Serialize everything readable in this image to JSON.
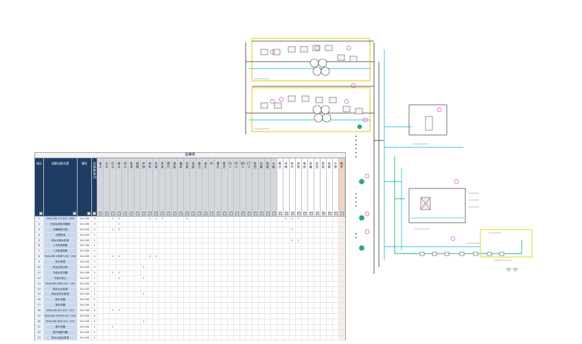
{
  "sheet": {
    "title": "設備表",
    "headers": [
      "項次",
      "設備名稱/位置",
      "類型",
      "設備數量(台)",
      "進水",
      "出水",
      "回水",
      "補水",
      "排水",
      "電源",
      "開關",
      "控制",
      "感知",
      "泵浦",
      "馬達",
      "閥門",
      "管路",
      "儀表",
      "流量",
      "溫度",
      "壓力",
      "液位",
      "AC",
      "備註",
      "電控",
      "PLC",
      "RTU",
      "EMS",
      "CTU",
      "監控",
      "加藥",
      "過濾",
      "水箱",
      "備註",
      "採樣",
      "附件",
      "狀態",
      "維修",
      "保養",
      "保固",
      "更換",
      "巡檢",
      "日期",
      "備考"
    ],
    "header_colors": [
      "navy",
      "navy",
      "navy",
      "navy",
      "grey",
      "grey",
      "grey",
      "grey",
      "grey",
      "grey",
      "grey",
      "grey",
      "grey",
      "grey",
      "grey",
      "grey",
      "grey",
      "grey",
      "grey",
      "grey",
      "grey",
      "grey",
      "grey",
      "grey",
      "grey",
      "grey",
      "grey",
      "grey",
      "grey",
      "grey",
      "grey",
      "grey",
      "grey",
      "white",
      "white",
      "white",
      "white",
      "white",
      "white",
      "white",
      "white",
      "white",
      "white",
      "peach"
    ],
    "rows": [
      [
        "1",
        "FASA-ME-CH-201~204",
        "2A-CUB",
        "4",
        "",
        "",
        "1",
        "1",
        "",
        "",
        "",
        "",
        "1",
        "1",
        "1",
        "",
        "",
        "",
        "1",
        "",
        "",
        "",
        "",
        "",
        "",
        "",
        "",
        "",
        "",
        "",
        "",
        "",
        "",
        "",
        "1",
        "1",
        "1",
        "",
        "",
        "",
        "",
        "",
        "",
        ""
      ],
      [
        "2",
        "冷卻水泵與本體機",
        "2A-CUB",
        "2",
        "",
        "",
        "",
        "1",
        "",
        "",
        "",
        "",
        "",
        "",
        "",
        "",
        "",
        "",
        "",
        "",
        "",
        "",
        "",
        "",
        "",
        "",
        "",
        "",
        "",
        "",
        "",
        "",
        "",
        "",
        "",
        "",
        "",
        "",
        "",
        "",
        "",
        "",
        "",
        ""
      ],
      [
        "3",
        "冰機機房冷卻",
        "2A-CUB",
        "2",
        "",
        "",
        "1",
        "1",
        "",
        "",
        "",
        "",
        "",
        "",
        "",
        "",
        "",
        "",
        "",
        "",
        "",
        "",
        "",
        "",
        "",
        "",
        "",
        "",
        "",
        "",
        "",
        "",
        "",
        "",
        "",
        "1",
        "",
        "",
        "",
        "",
        "",
        "",
        "",
        ""
      ],
      [
        "4",
        "主要泵浦",
        "2A-CUB",
        "1",
        "",
        "",
        "",
        "",
        "",
        "",
        "",
        "",
        "",
        "",
        "",
        "",
        "",
        "",
        "",
        "",
        "",
        "",
        "",
        "",
        "",
        "",
        "",
        "",
        "",
        "",
        "",
        "",
        "",
        "",
        "",
        "",
        "",
        "",
        "",
        "",
        "",
        "",
        "",
        ""
      ],
      [
        "5",
        "熱水空調水泵浦",
        "2A-CUB",
        "1",
        "",
        "",
        "",
        "",
        "",
        "",
        "",
        "",
        "",
        "",
        "",
        "",
        "",
        "",
        "",
        "",
        "",
        "",
        "",
        "",
        "",
        "",
        "",
        "",
        "",
        "",
        "",
        "",
        "",
        "",
        "",
        "1",
        "1",
        "",
        "",
        "",
        "",
        "",
        "",
        ""
      ],
      [
        "6",
        "L-R泵浦本體",
        "2A-CUB",
        "1",
        "",
        "",
        "",
        "",
        "",
        "",
        "",
        "",
        "",
        "",
        "",
        "",
        "",
        "",
        "",
        "",
        "",
        "",
        "",
        "",
        "",
        "",
        "",
        "",
        "",
        "",
        "",
        "",
        "",
        "",
        "",
        "",
        "",
        "",
        "",
        "",
        "",
        "",
        "",
        ""
      ],
      [
        "7",
        "L-R泵浦本體",
        "2A-CUB",
        "1",
        "",
        "",
        "",
        "",
        "",
        "",
        "",
        "",
        "",
        "",
        "",
        "",
        "",
        "",
        "",
        "",
        "",
        "",
        "",
        "",
        "",
        "",
        "",
        "",
        "",
        "",
        "",
        "",
        "",
        "",
        "",
        "",
        "",
        "",
        "",
        "",
        "",
        "",
        "",
        ""
      ],
      [
        "8",
        "FASA-ME-HRWP-202~204",
        "2A-CUB",
        "4",
        "",
        "",
        "1",
        "1",
        "",
        "",
        "",
        "",
        "1",
        "1",
        "",
        "",
        "",
        "",
        "",
        "",
        "",
        "",
        "",
        "",
        "",
        "",
        "",
        "",
        "",
        "",
        "",
        "",
        "",
        "",
        "",
        "",
        "",
        "",
        "",
        "",
        "",
        "",
        "",
        ""
      ],
      [
        "9",
        "熱水泵頭",
        "2A-CUB",
        "1",
        "",
        "",
        "",
        "",
        "",
        "",
        "",
        "",
        "",
        "",
        "",
        "",
        "",
        "",
        "",
        "",
        "",
        "",
        "",
        "",
        "",
        "",
        "",
        "",
        "",
        "",
        "",
        "",
        "",
        "",
        "",
        "",
        "",
        "",
        "",
        "",
        "",
        "",
        "",
        ""
      ],
      [
        "10",
        "熱水回流水泵",
        "2A-CUB",
        "2",
        "",
        "",
        "",
        "",
        "",
        "",
        "",
        "1",
        "",
        "",
        "",
        "",
        "",
        "",
        "",
        "",
        "",
        "",
        "",
        "",
        "",
        "",
        "",
        "",
        "",
        "",
        "",
        "",
        "",
        "",
        "",
        "",
        "",
        "",
        "",
        "",
        "",
        "",
        "",
        ""
      ],
      [
        "11",
        "冷卻水泵本體",
        "2A-CUB",
        "2",
        "",
        "",
        "1",
        "1",
        "",
        "",
        "",
        "",
        "",
        "",
        "",
        "",
        "",
        "",
        "",
        "",
        "",
        "",
        "",
        "",
        "",
        "",
        "",
        "",
        "",
        "",
        "",
        "",
        "",
        "",
        "",
        "",
        "",
        "",
        "",
        "",
        "",
        "",
        "",
        ""
      ],
      [
        "12",
        "冷卻水泵主",
        "2A-CUB",
        "1",
        "",
        "",
        "",
        "1",
        "",
        "",
        "",
        "1",
        "",
        "",
        "",
        "",
        "",
        "",
        "",
        "",
        "",
        "",
        "",
        "",
        "",
        "",
        "",
        "",
        "",
        "",
        "",
        "",
        "",
        "",
        "",
        "",
        "",
        "",
        "",
        "",
        "",
        "",
        "",
        ""
      ],
      [
        "13",
        "FASA-ME-HWP-201~202",
        "2A-CUB",
        "2",
        "",
        "",
        "",
        "",
        "",
        "",
        "",
        "",
        "",
        "",
        "",
        "",
        "",
        "",
        "",
        "",
        "",
        "",
        "",
        "",
        "",
        "",
        "",
        "",
        "",
        "",
        "",
        "",
        "",
        "",
        "",
        "",
        "",
        "",
        "",
        "",
        "",
        "",
        "",
        ""
      ],
      [
        "14",
        "熱水出水泵浦",
        "2A-CUB",
        "1",
        "",
        "",
        "",
        "",
        "",
        "",
        "",
        "",
        "",
        "",
        "",
        "",
        "",
        "",
        "",
        "",
        "",
        "",
        "",
        "",
        "",
        "",
        "",
        "",
        "",
        "",
        "",
        "",
        "",
        "",
        "",
        "",
        "",
        "",
        "",
        "",
        "",
        "",
        "",
        ""
      ],
      [
        "15",
        "熱水回流水泵浦",
        "2A-CUB",
        "1",
        "",
        "",
        "",
        "",
        "",
        "",
        "",
        "1",
        "",
        "",
        "",
        "",
        "",
        "",
        "",
        "",
        "",
        "",
        "",
        "",
        "",
        "",
        "",
        "",
        "",
        "",
        "",
        "",
        "",
        "",
        "",
        "",
        "",
        "",
        "",
        "",
        "",
        "",
        "",
        ""
      ],
      [
        "16",
        "熱水本體",
        "2A-CUB",
        "1",
        "",
        "",
        "",
        "",
        "",
        "",
        "",
        "",
        "",
        "",
        "",
        "",
        "",
        "",
        "",
        "",
        "",
        "",
        "",
        "",
        "",
        "",
        "",
        "",
        "",
        "",
        "",
        "",
        "",
        "",
        "",
        "",
        "",
        "",
        "",
        "",
        "",
        "",
        "",
        ""
      ],
      [
        "17",
        "熱水本體",
        "2A-CUB",
        "1",
        "",
        "",
        "",
        "",
        "",
        "",
        "",
        "",
        "",
        "",
        "",
        "",
        "",
        "",
        "",
        "",
        "",
        "",
        "",
        "",
        "",
        "",
        "",
        "",
        "",
        "",
        "",
        "",
        "",
        "",
        "",
        "",
        "",
        "",
        "",
        "",
        "",
        "",
        "",
        ""
      ],
      [
        "18",
        "FASA-ME-BO-201~202",
        "2A-CUB",
        "2",
        "",
        "",
        "1",
        "1",
        "",
        "",
        "",
        "",
        "",
        "",
        "",
        "",
        "",
        "",
        "",
        "",
        "",
        "",
        "",
        "",
        "",
        "",
        "",
        "",
        "",
        "",
        "",
        "",
        "",
        "",
        "",
        "",
        "",
        "",
        "",
        "",
        "",
        "",
        "",
        ""
      ],
      [
        "19",
        "FASA-ME-HHWP-201~202",
        "2A-CUB",
        "2",
        "",
        "",
        "",
        "",
        "",
        "",
        "",
        "",
        "",
        "",
        "",
        "",
        "",
        "",
        "",
        "",
        "",
        "",
        "",
        "",
        "",
        "",
        "",
        "",
        "",
        "",
        "",
        "",
        "",
        "",
        "",
        "",
        "",
        "",
        "",
        "",
        "",
        "",
        "",
        ""
      ],
      [
        "20",
        "FASA-ME-HEX-201~202",
        "2A-CUB",
        "2",
        "",
        "",
        "",
        "",
        "",
        "",
        "",
        "1",
        "",
        "",
        "",
        "",
        "",
        "",
        "",
        "",
        "",
        "",
        "",
        "",
        "",
        "",
        "",
        "",
        "",
        "",
        "",
        "",
        "",
        "",
        "",
        "",
        "",
        "",
        "",
        "",
        "",
        "",
        "",
        ""
      ],
      [
        "21",
        "蒸汽本體",
        "2A-CUB",
        "1",
        "",
        "",
        "1",
        "",
        "",
        "",
        "",
        "",
        "",
        "",
        "",
        "",
        "",
        "",
        "",
        "",
        "",
        "",
        "",
        "",
        "",
        "",
        "",
        "",
        "",
        "",
        "",
        "",
        "",
        "",
        "",
        "",
        "",
        "",
        "",
        "",
        "",
        "",
        "",
        ""
      ],
      [
        "22",
        "蒸汽鍋爐本體",
        "2A-CUB",
        "1",
        "",
        "",
        "",
        "",
        "",
        "",
        "",
        "",
        "",
        "",
        "",
        "",
        "",
        "",
        "",
        "",
        "",
        "",
        "",
        "",
        "",
        "",
        "",
        "",
        "",
        "",
        "",
        "",
        "",
        "",
        "",
        "",
        "",
        "",
        "",
        "",
        "",
        "",
        "",
        ""
      ],
      [
        "23",
        "熱水出回水泵浦",
        "2A-CUB",
        "1",
        "",
        "",
        "",
        "",
        "",
        "",
        "",
        "",
        "",
        "",
        "",
        "",
        "",
        "",
        "",
        "",
        "",
        "",
        "",
        "",
        "",
        "",
        "",
        "",
        "",
        "",
        "",
        "",
        "",
        "",
        "",
        "",
        "",
        "",
        "",
        "",
        "",
        "",
        "",
        ""
      ]
    ]
  },
  "diagram": {
    "accent_green": "#19b37a",
    "accent_magenta": "#e23be0",
    "accent_cyan": "#2ec6d8",
    "accent_yellow": "#e8d84a"
  }
}
